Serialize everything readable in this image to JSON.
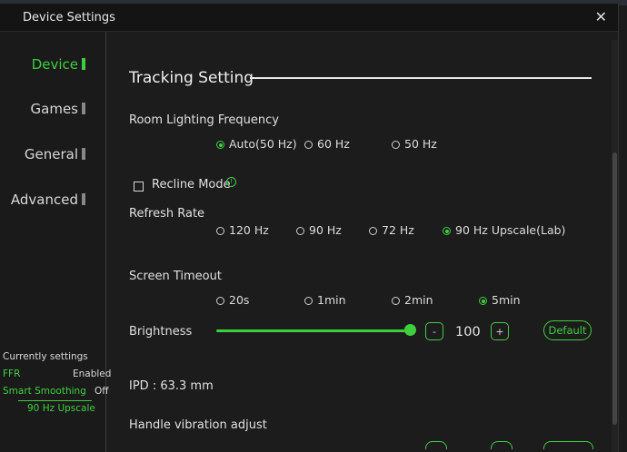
{
  "window": {
    "title": "Device Settings",
    "close_glyph": "✕"
  },
  "sidebar": {
    "items": [
      {
        "label": "Device",
        "active": true
      },
      {
        "label": "Games",
        "active": false
      },
      {
        "label": "General",
        "active": false
      },
      {
        "label": "Advanced",
        "active": false
      }
    ],
    "current": {
      "heading": "Currently settings",
      "rows": [
        {
          "name": "FFR",
          "value": "Enabled"
        },
        {
          "name": "Smart Smoothing",
          "value": "Off"
        }
      ],
      "refresh": "90 Hz Upscale"
    }
  },
  "main": {
    "section_title": "Tracking Setting",
    "room_lighting": {
      "label": "Room Lighting Frequency",
      "options": [
        "Auto(50 Hz)",
        "60 Hz",
        "50 Hz"
      ],
      "selected": "Auto(50 Hz)"
    },
    "recline": {
      "label": "Recline Mode",
      "checked": false,
      "info_glyph": "!"
    },
    "refresh_rate": {
      "label": "Refresh Rate",
      "options": [
        "120 Hz",
        "90 Hz",
        "72 Hz",
        "90 Hz Upscale(Lab)"
      ],
      "selected": "90 Hz Upscale(Lab)"
    },
    "screen_timeout": {
      "label": "Screen Timeout",
      "options": [
        "20s",
        "1min",
        "2min",
        "5min"
      ],
      "selected": "5min"
    },
    "brightness": {
      "label": "Brightness",
      "value": "100",
      "level_percent": 100,
      "minus": "-",
      "plus": "+",
      "default_label": "Default"
    },
    "ipd": "IPD : 63.3 mm",
    "handle_vibration": "Handle vibration adjust"
  },
  "colors": {
    "accent": "#3ecf3e",
    "background": "#1c1c1c",
    "titlebar": "#141414"
  }
}
